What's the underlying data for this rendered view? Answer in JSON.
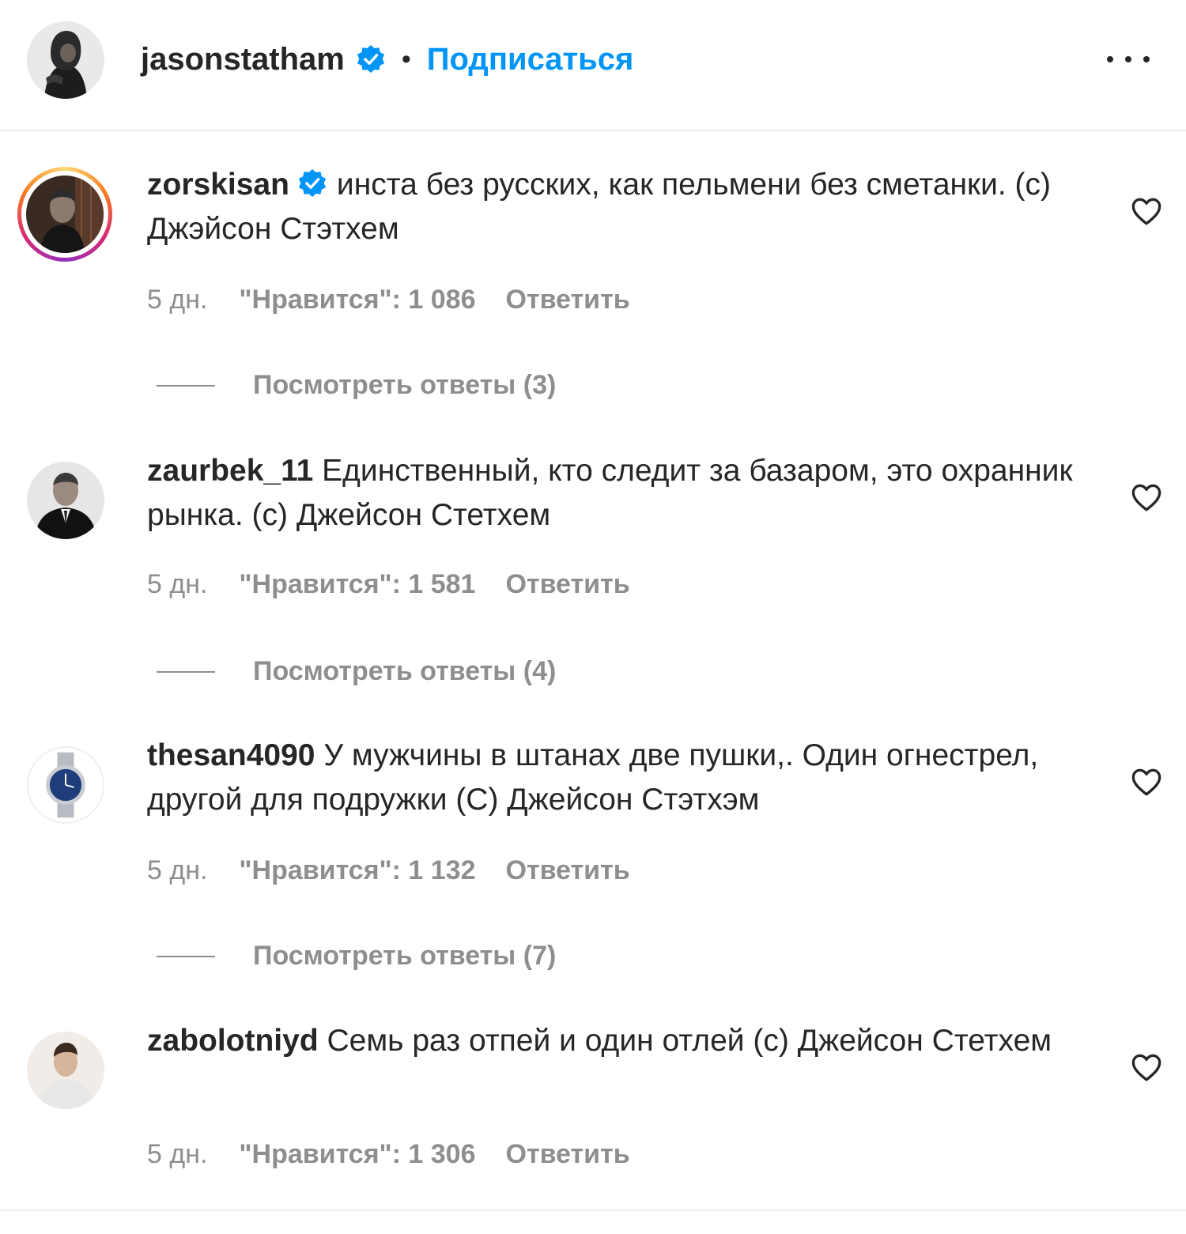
{
  "post_header": {
    "username": "jasonstatham",
    "separator": "•",
    "follow_label": "Подписаться",
    "more_icon": "more-horizontal-icon"
  },
  "comments": [
    {
      "username": "zorskisan",
      "verified": true,
      "text": "инста без русских, как пельмени без сметанки. (с) Джэйсон Стэтхем",
      "time": "5 дн.",
      "likes": "\"Нравится\": 1 086",
      "reply_label": "Ответить",
      "view_replies": "Посмотреть ответы (3)"
    },
    {
      "username": "zaurbek_11",
      "verified": false,
      "text": "Единственный, кто следит за базаром, это охранник рынка. (с) Джейсон Стетхем",
      "time": "5 дн.",
      "likes": "\"Нравится\": 1 581",
      "reply_label": "Ответить",
      "view_replies": "Посмотреть ответы (4)"
    },
    {
      "username": "thesan4090",
      "verified": false,
      "text": "У мужчины в штанах две пушки,. Один огнестрел, другой для подружки (С) Джейсон Стэтхэм",
      "time": "5 дн.",
      "likes": "\"Нравится\": 1 132",
      "reply_label": "Ответить",
      "view_replies": "Посмотреть ответы (7)"
    },
    {
      "username": "zabolotniyd",
      "verified": false,
      "text": "Семь раз отпей и один отлей (с) Джейсон Стетхем",
      "time": "5 дн.",
      "likes": "\"Нравится\": 1 306",
      "reply_label": "Ответить"
    }
  ],
  "colors": {
    "link_blue": "#0095f6",
    "verified_blue": "#0095f6",
    "text_primary": "#262626",
    "text_secondary": "#8e8e8e",
    "divider": "#efefef"
  }
}
